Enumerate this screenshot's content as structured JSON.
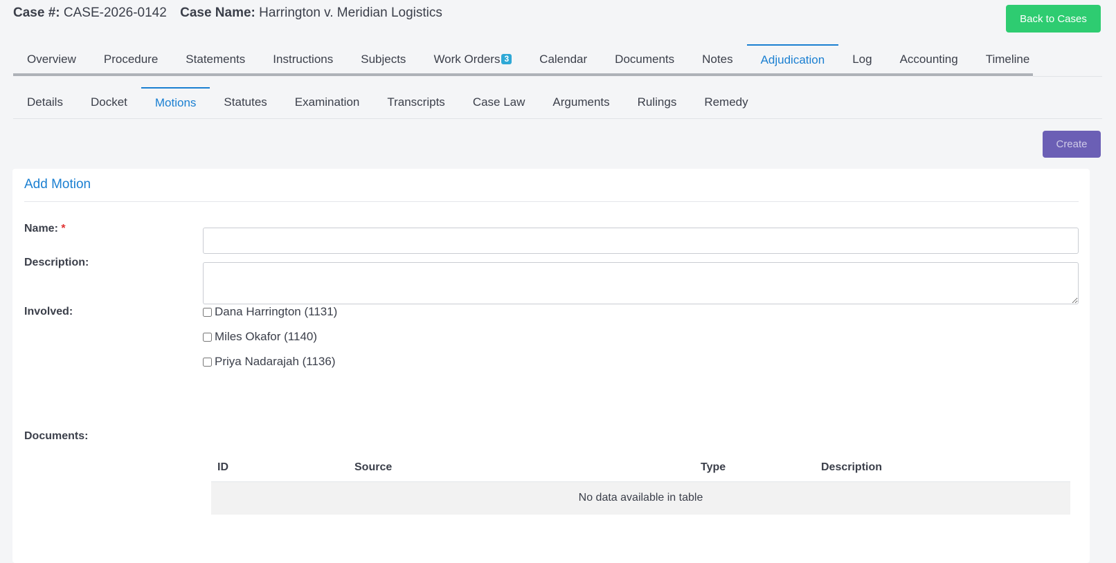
{
  "header": {
    "case_number_label": "Case #:",
    "case_number": "CASE-2026-0142",
    "case_name_label": "Case Name:",
    "case_name": "Harrington v. Meridian Logistics",
    "back_button": "Back to Cases"
  },
  "main_tabs": [
    {
      "label": "Overview"
    },
    {
      "label": "Procedure"
    },
    {
      "label": "Statements"
    },
    {
      "label": "Instructions"
    },
    {
      "label": "Subjects"
    },
    {
      "label": "Work Orders",
      "badge": "3"
    },
    {
      "label": "Calendar"
    },
    {
      "label": "Documents"
    },
    {
      "label": "Notes"
    },
    {
      "label": "Adjudication",
      "active": true
    },
    {
      "label": "Log"
    },
    {
      "label": "Accounting"
    },
    {
      "label": "Timeline"
    }
  ],
  "sub_tabs": [
    {
      "label": "Details"
    },
    {
      "label": "Docket"
    },
    {
      "label": "Motions",
      "active": true
    },
    {
      "label": "Statutes"
    },
    {
      "label": "Examination"
    },
    {
      "label": "Transcripts"
    },
    {
      "label": "Case Law"
    },
    {
      "label": "Arguments"
    },
    {
      "label": "Rulings"
    },
    {
      "label": "Remedy"
    }
  ],
  "toolbar": {
    "create_label": "Create"
  },
  "form": {
    "title": "Add Motion",
    "name_label": "Name:",
    "required_mark": "*",
    "name_value": "",
    "description_label": "Description:",
    "description_value": "",
    "involved_label": "Involved:",
    "involved": [
      {
        "label": "Dana Harrington (1131)",
        "checked": false
      },
      {
        "label": "Miles Okafor (1140)",
        "checked": false
      },
      {
        "label": "Priya Nadarajah (1136)",
        "checked": false
      }
    ],
    "documents_label": "Documents:"
  },
  "documents_table": {
    "columns": [
      "ID",
      "Source",
      "Type",
      "Description"
    ],
    "empty_message": "No data available in table"
  },
  "colors": {
    "accent": "#1a7fd1",
    "success": "#2ecc71",
    "primary": "#6b5fb5",
    "badge": "#2ea8d6"
  }
}
